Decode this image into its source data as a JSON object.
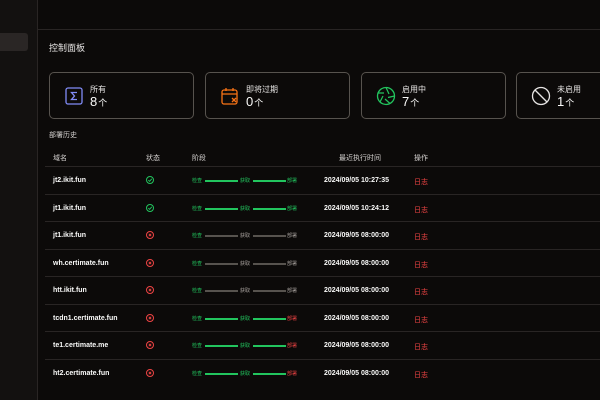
{
  "page": {
    "title": "控制面板",
    "section_title": "部署历史"
  },
  "stats": [
    {
      "label": "所有",
      "value": "8",
      "unit": "个",
      "icon": "sigma-icon",
      "color": "#6366f1"
    },
    {
      "label": "即将过期",
      "value": "0",
      "unit": "个",
      "icon": "calendar-x-icon",
      "color": "#f97316"
    },
    {
      "label": "启用中",
      "value": "7",
      "unit": "个",
      "icon": "aperture-icon",
      "color": "#22c55e"
    },
    {
      "label": "未启用",
      "value": "1",
      "unit": "个",
      "icon": "ban-icon",
      "color": "#e7e5e4"
    }
  ],
  "table": {
    "headers": {
      "domain": "域名",
      "status": "状态",
      "stage": "阶段",
      "last_run": "最近执行时间",
      "action": "操作"
    },
    "stage_labels": [
      "检查",
      "获取",
      "部署"
    ],
    "rows": [
      {
        "domain": "jt2.ikit.fun",
        "status": "ok",
        "stages": [
          "green",
          "green",
          "green"
        ],
        "bars": [
          "green",
          "green"
        ],
        "time": "2024/09/05 10:27:35",
        "action": "日志"
      },
      {
        "domain": "jt1.ikit.fun",
        "status": "ok",
        "stages": [
          "green",
          "green",
          "green"
        ],
        "bars": [
          "green",
          "green"
        ],
        "time": "2024/09/05 10:24:12",
        "action": "日志"
      },
      {
        "domain": "jt1.ikit.fun",
        "status": "fail",
        "stages": [
          "green",
          "gray",
          "gray"
        ],
        "bars": [
          "gray",
          "gray"
        ],
        "time": "2024/09/05 08:00:00",
        "action": "日志"
      },
      {
        "domain": "wh.certimate.fun",
        "status": "fail",
        "stages": [
          "green",
          "gray",
          "gray"
        ],
        "bars": [
          "gray",
          "gray"
        ],
        "time": "2024/09/05 08:00:00",
        "action": "日志"
      },
      {
        "domain": "htt.ikit.fun",
        "status": "fail",
        "stages": [
          "green",
          "gray",
          "gray"
        ],
        "bars": [
          "gray",
          "gray"
        ],
        "time": "2024/09/05 08:00:00",
        "action": "日志"
      },
      {
        "domain": "tcdn1.certimate.fun",
        "status": "fail",
        "stages": [
          "green",
          "green",
          "red"
        ],
        "bars": [
          "green",
          "green"
        ],
        "time": "2024/09/05 08:00:00",
        "action": "日志"
      },
      {
        "domain": "te1.certimate.me",
        "status": "fail",
        "stages": [
          "green",
          "green",
          "red"
        ],
        "bars": [
          "green",
          "green"
        ],
        "time": "2024/09/05 08:00:00",
        "action": "日志"
      },
      {
        "domain": "ht2.certimate.fun",
        "status": "fail",
        "stages": [
          "green",
          "green",
          "red"
        ],
        "bars": [
          "green",
          "green"
        ],
        "time": "2024/09/05 08:00:00",
        "action": "日志"
      }
    ]
  }
}
